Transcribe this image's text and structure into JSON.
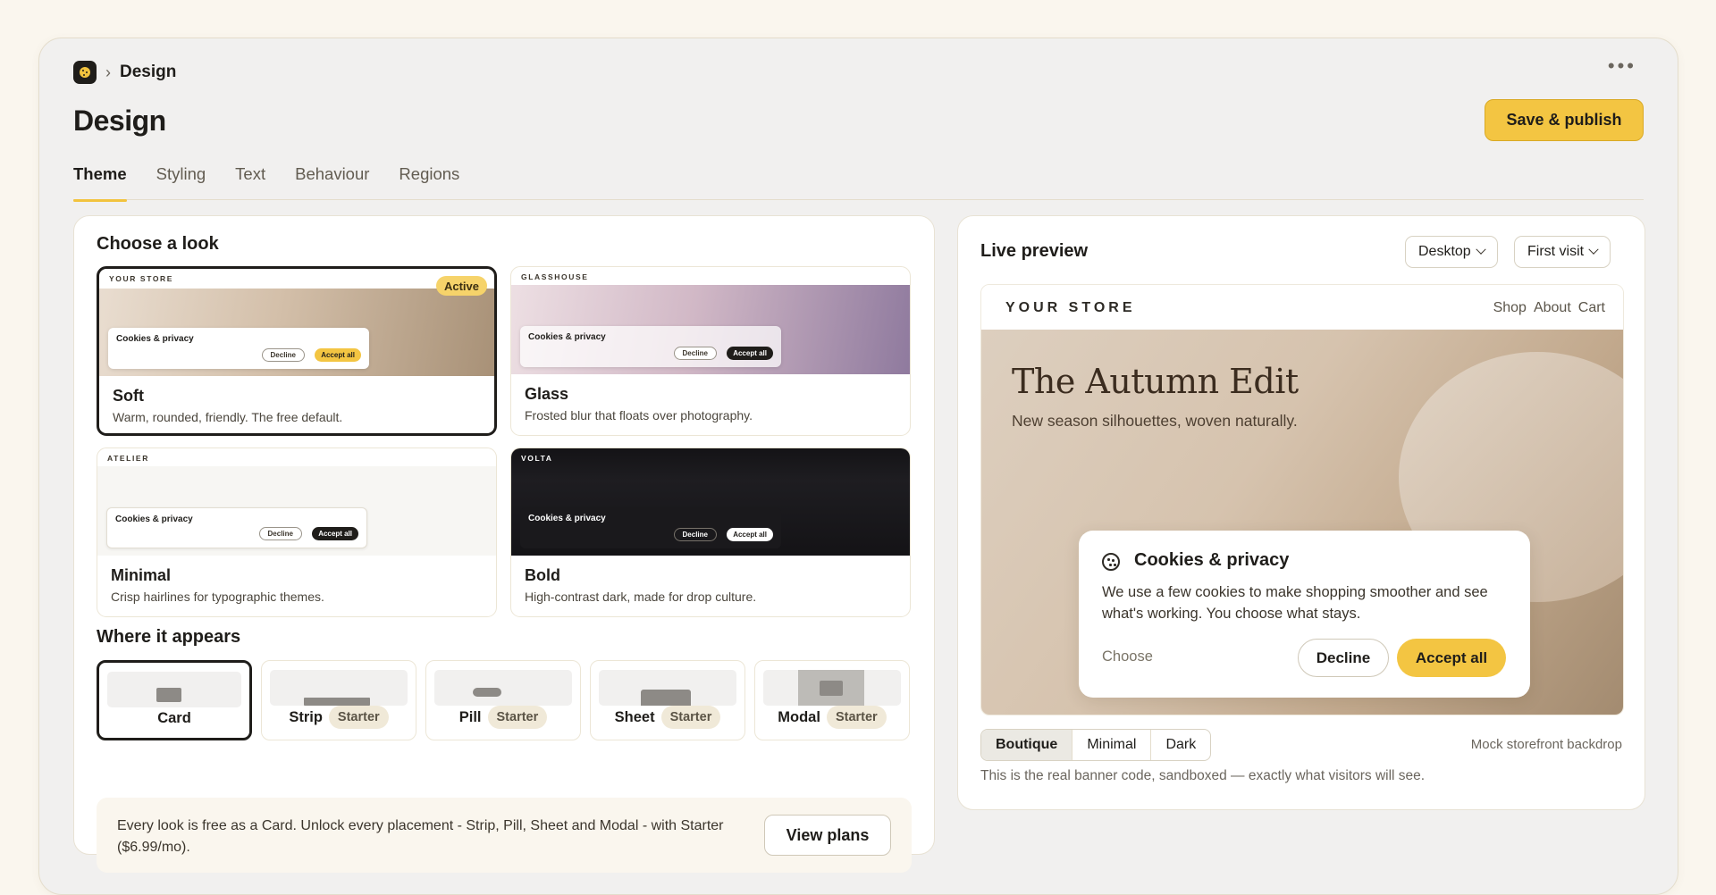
{
  "breadcrumb": {
    "label": "Design"
  },
  "header": {
    "title": "Design",
    "publish_label": "Save & publish"
  },
  "tabs": [
    {
      "label": "Theme"
    },
    {
      "label": "Styling"
    },
    {
      "label": "Text"
    },
    {
      "label": "Behaviour"
    },
    {
      "label": "Regions"
    }
  ],
  "choose": {
    "title": "Choose a look",
    "active_badge": "Active",
    "banner_title": "Cookies & privacy",
    "decline": "Decline",
    "accept": "Accept all",
    "looks": [
      {
        "store": "YOUR STORE",
        "name": "Soft",
        "desc": "Warm, rounded, friendly. The free default.",
        "active": true
      },
      {
        "store": "GLASSHOUSE",
        "name": "Glass",
        "desc": "Frosted blur that floats over photography.",
        "active": false
      },
      {
        "store": "ATELIER",
        "name": "Minimal",
        "desc": "Crisp hairlines for typographic themes.",
        "active": false
      },
      {
        "store": "VOLTA",
        "name": "Bold",
        "desc": "High-contrast dark, made for drop culture.",
        "active": false
      }
    ]
  },
  "placement": {
    "title": "Where it appears",
    "starter_badge": "Starter",
    "items": [
      {
        "label": "Card",
        "locked": false,
        "active": true
      },
      {
        "label": "Strip",
        "locked": true,
        "active": false
      },
      {
        "label": "Pill",
        "locked": true,
        "active": false
      },
      {
        "label": "Sheet",
        "locked": true,
        "active": false
      },
      {
        "label": "Modal",
        "locked": true,
        "active": false
      }
    ]
  },
  "upsell": {
    "text": "Every look is free as a Card. Unlock every placement - Strip, Pill, Sheet and Modal - with Starter ($6.99/mo).",
    "button": "View plans"
  },
  "preview": {
    "title": "Live preview",
    "device": "Desktop",
    "visit": "First visit",
    "store_name": "YOUR STORE",
    "nav_links": [
      "Shop",
      "About",
      "Cart"
    ],
    "hero_title": "The Autumn Edit",
    "hero_sub": "New season silhouettes, woven naturally.",
    "banner": {
      "title": "Cookies & privacy",
      "body": "We use a few cookies to make shopping smoother and see what's working. You choose what stays.",
      "choose": "Choose",
      "decline": "Decline",
      "accept": "Accept all"
    },
    "backdrops": [
      "Boutique",
      "Minimal",
      "Dark"
    ],
    "backdrop_selected": "Boutique",
    "backdrop_note": "Mock storefront backdrop",
    "footnote": "This is the real banner code, sandboxed — exactly what visitors will see."
  },
  "colors": {
    "accent": "#f3c542",
    "ink": "#1f1d1a",
    "page_bg": "#faf6ee"
  }
}
